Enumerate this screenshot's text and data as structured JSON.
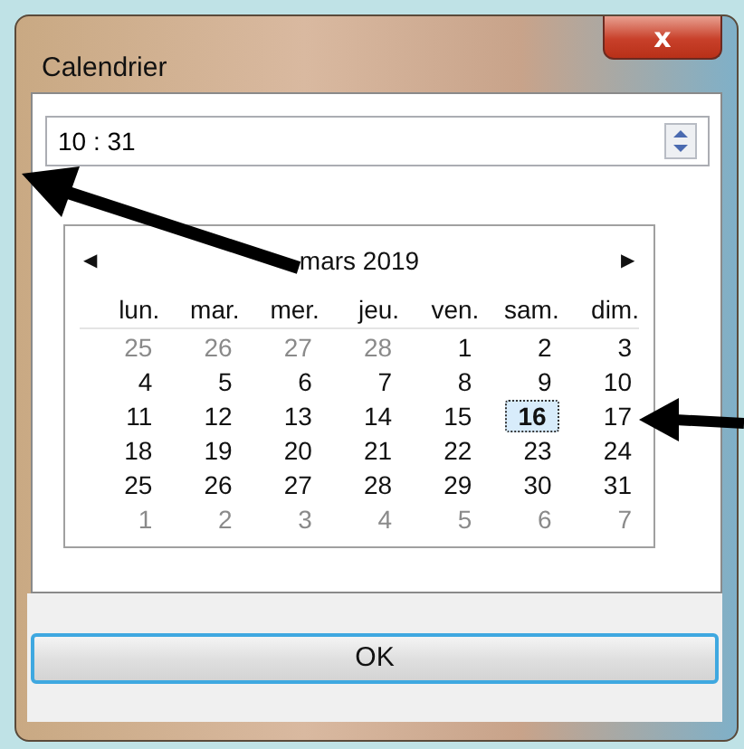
{
  "window": {
    "title": "Calendrier",
    "close": "x"
  },
  "time_field": {
    "value": "10 : 31"
  },
  "calendar": {
    "month": "mars 2019",
    "prev": "◀",
    "next": "▶",
    "weekdays": [
      "lun.",
      "mar.",
      "mer.",
      "jeu.",
      "ven.",
      "sam.",
      "dim."
    ],
    "days": [
      {
        "label": "25",
        "other_month": true,
        "selected": false
      },
      {
        "label": "26",
        "other_month": true,
        "selected": false
      },
      {
        "label": "27",
        "other_month": true,
        "selected": false
      },
      {
        "label": "28",
        "other_month": true,
        "selected": false
      },
      {
        "label": "1",
        "other_month": false,
        "selected": false
      },
      {
        "label": "2",
        "other_month": false,
        "selected": false
      },
      {
        "label": "3",
        "other_month": false,
        "selected": false
      },
      {
        "label": "4",
        "other_month": false,
        "selected": false
      },
      {
        "label": "5",
        "other_month": false,
        "selected": false
      },
      {
        "label": "6",
        "other_month": false,
        "selected": false
      },
      {
        "label": "7",
        "other_month": false,
        "selected": false
      },
      {
        "label": "8",
        "other_month": false,
        "selected": false
      },
      {
        "label": "9",
        "other_month": false,
        "selected": false
      },
      {
        "label": "10",
        "other_month": false,
        "selected": false
      },
      {
        "label": "11",
        "other_month": false,
        "selected": false
      },
      {
        "label": "12",
        "other_month": false,
        "selected": false
      },
      {
        "label": "13",
        "other_month": false,
        "selected": false
      },
      {
        "label": "14",
        "other_month": false,
        "selected": false
      },
      {
        "label": "15",
        "other_month": false,
        "selected": false
      },
      {
        "label": "16",
        "other_month": false,
        "selected": true
      },
      {
        "label": "17",
        "other_month": false,
        "selected": false
      },
      {
        "label": "18",
        "other_month": false,
        "selected": false
      },
      {
        "label": "19",
        "other_month": false,
        "selected": false
      },
      {
        "label": "20",
        "other_month": false,
        "selected": false
      },
      {
        "label": "21",
        "other_month": false,
        "selected": false
      },
      {
        "label": "22",
        "other_month": false,
        "selected": false
      },
      {
        "label": "23",
        "other_month": false,
        "selected": false
      },
      {
        "label": "24",
        "other_month": false,
        "selected": false
      },
      {
        "label": "25",
        "other_month": false,
        "selected": false
      },
      {
        "label": "26",
        "other_month": false,
        "selected": false
      },
      {
        "label": "27",
        "other_month": false,
        "selected": false
      },
      {
        "label": "28",
        "other_month": false,
        "selected": false
      },
      {
        "label": "29",
        "other_month": false,
        "selected": false
      },
      {
        "label": "30",
        "other_month": false,
        "selected": false
      },
      {
        "label": "31",
        "other_month": false,
        "selected": false
      },
      {
        "label": "1",
        "other_month": true,
        "selected": false
      },
      {
        "label": "2",
        "other_month": true,
        "selected": false
      },
      {
        "label": "3",
        "other_month": true,
        "selected": false
      },
      {
        "label": "4",
        "other_month": true,
        "selected": false
      },
      {
        "label": "5",
        "other_month": true,
        "selected": false
      },
      {
        "label": "6",
        "other_month": true,
        "selected": false
      },
      {
        "label": "7",
        "other_month": true,
        "selected": false
      }
    ]
  },
  "buttons": [
    "OK"
  ]
}
